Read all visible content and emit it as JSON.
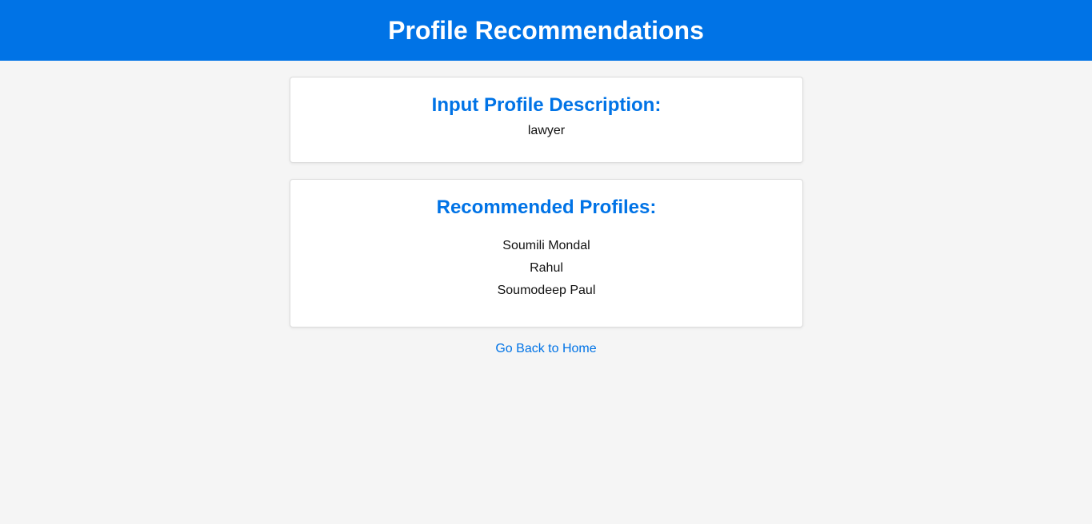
{
  "header": {
    "title": "Profile Recommendations"
  },
  "input_card": {
    "heading": "Input Profile Description:",
    "value": "lawyer"
  },
  "recommendations_card": {
    "heading": "Recommended Profiles:",
    "profiles": [
      "Soumili Mondal",
      "Rahul",
      "Soumodeep Paul"
    ]
  },
  "footer": {
    "back_link": "Go Back to Home"
  },
  "colors": {
    "accent": "#0073e6",
    "background": "#f5f5f5"
  }
}
